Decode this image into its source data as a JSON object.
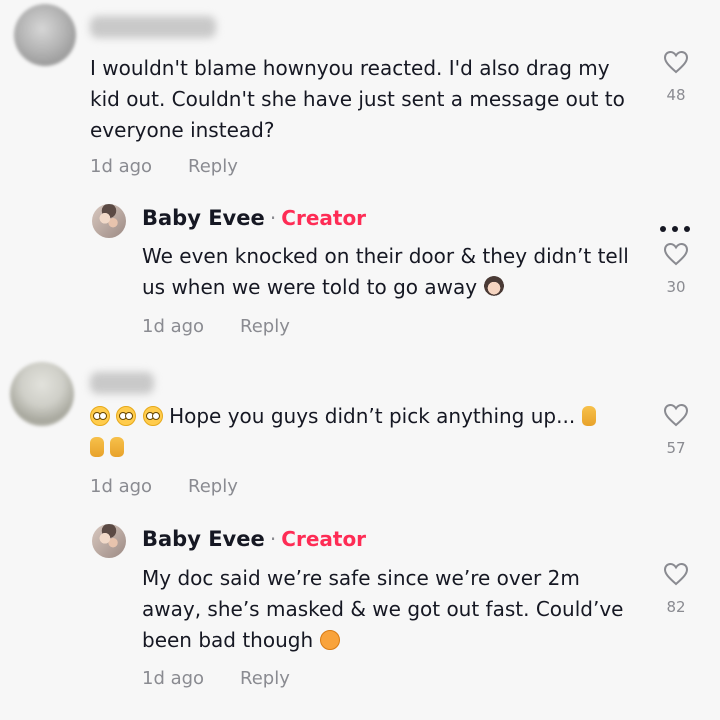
{
  "comments": [
    {
      "text": "I wouldn't blame hownyou reacted. I'd also drag my kid out. Couldn't she have just sent a message out to everyone instead?",
      "lines": [
        "I wouldn't blame hownyou reacted. I'd also drag my",
        "kid out. Couldn't she have just sent a message out to",
        "everyone instead?"
      ],
      "time": "1d ago",
      "reply_label": "Reply",
      "likes": "48"
    },
    {
      "author": "Baby Evee",
      "badge": "Creator",
      "separator": "·",
      "lines": [
        "We even knocked on their door & they didn’t tell",
        "us when we were told to go away"
      ],
      "emoji": "woman-facepalming",
      "time": "1d ago",
      "reply_label": "Reply",
      "likes": "30",
      "more_icon": "more-dots-icon"
    },
    {
      "line1_text": "Hope you guys didn’t pick anything up...",
      "emojis_line1_before": [
        "flushed-face",
        "flushed-face",
        "flushed-face"
      ],
      "emojis_line1_after": [
        "crossed-fingers"
      ],
      "emojis_line2": [
        "crossed-fingers",
        "crossed-fingers"
      ],
      "time": "1d ago",
      "reply_label": "Reply",
      "likes": "57"
    },
    {
      "author": "Baby Evee",
      "badge": "Creator",
      "separator": "·",
      "lines": [
        "My doc said we’re safe since we’re over 2m",
        "away, she’s masked & we got out fast. Could’ve",
        "been bad though"
      ],
      "emoji": "angry-face",
      "time": "1d ago",
      "reply_label": "Reply",
      "likes": "82"
    }
  ],
  "colors": {
    "background": "#f7f7f7",
    "text": "#161823",
    "secondary": "#8a8b91",
    "creator_badge": "#fe2c55"
  }
}
